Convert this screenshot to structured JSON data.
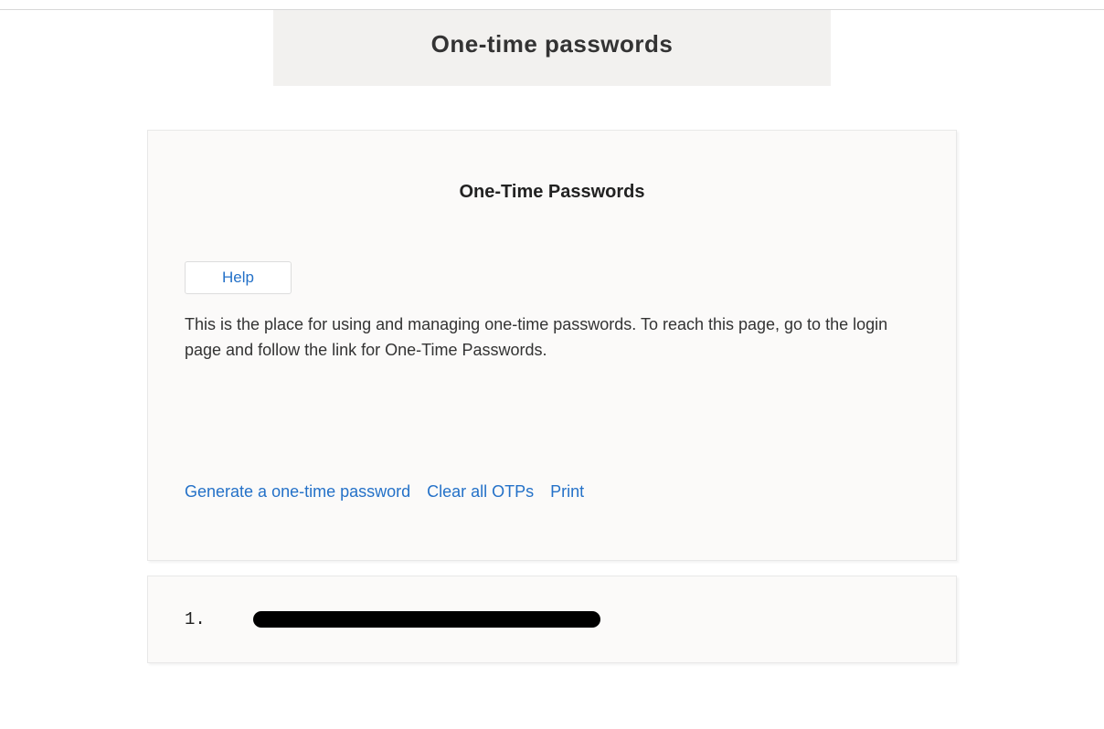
{
  "header": {
    "title": "One-time passwords"
  },
  "card": {
    "title": "One-Time Passwords",
    "help_label": "Help",
    "description": "This is the place for using and managing one-time passwords. To reach this page, go to the login page and follow the link for One-Time Passwords.",
    "actions": {
      "generate": "Generate a one-time password",
      "clear": "Clear all OTPs",
      "print": "Print"
    }
  },
  "list": {
    "items": [
      {
        "index": "1."
      }
    ]
  }
}
